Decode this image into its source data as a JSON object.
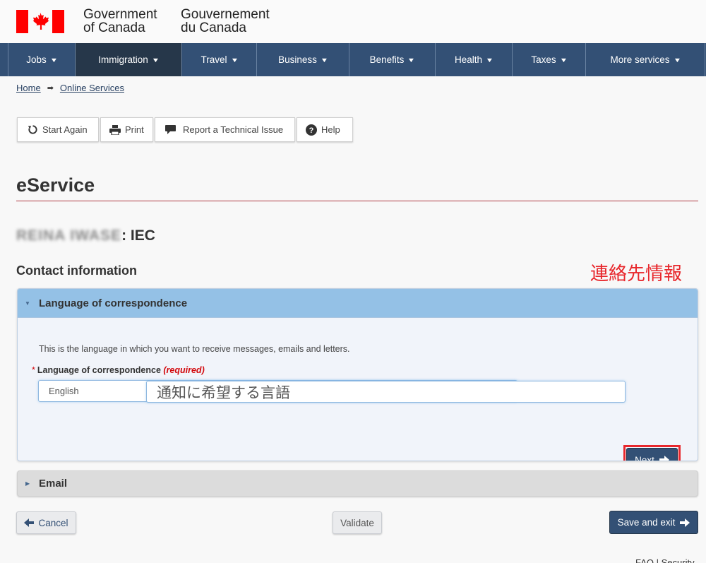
{
  "header": {
    "wordmark_en_line1": "Government",
    "wordmark_en_line2": "of Canada",
    "wordmark_fr_line1": "Gouvernement",
    "wordmark_fr_line2": "du Canada"
  },
  "nav": {
    "items": [
      {
        "label": "Jobs",
        "active": false
      },
      {
        "label": "Immigration",
        "active": true
      },
      {
        "label": "Travel",
        "active": false
      },
      {
        "label": "Business",
        "active": false
      },
      {
        "label": "Benefits",
        "active": false
      },
      {
        "label": "Health",
        "active": false
      },
      {
        "label": "Taxes",
        "active": false
      },
      {
        "label": "More services",
        "active": false
      }
    ]
  },
  "breadcrumb": {
    "items": [
      "Home",
      "Online Services"
    ]
  },
  "toolbar": {
    "start_again": "Start Again",
    "print": "Print",
    "report": "Report a Technical Issue",
    "help": "Help"
  },
  "page": {
    "title": "eService",
    "applicant_name": "REINA IWASE",
    "applicant_suffix": ": IEC",
    "section_title": "Contact information"
  },
  "annotations": {
    "section_jp": "連絡先情報",
    "select_jp": "通知に希望する言語",
    "color": "#e8272c"
  },
  "panel_language": {
    "heading": "Language of correspondence",
    "expanded": true,
    "intro": "This is the language in which you want to receive messages, emails and letters.",
    "field_label": "Language of correspondence",
    "required_marker": "*",
    "required_text": "(required)",
    "selected_value": "English",
    "next_label": "Next"
  },
  "panel_email": {
    "heading": "Email",
    "expanded": false
  },
  "actions": {
    "cancel": "Cancel",
    "validate": "Validate",
    "save_exit": "Save and exit"
  },
  "footer": {
    "links": "FAQ | Security"
  },
  "colors": {
    "nav_bg": "#335075",
    "nav_active": "#26374a",
    "panel_header": "#94c1e6",
    "title_rule": "#af3c43",
    "primary_btn": "#335075"
  }
}
